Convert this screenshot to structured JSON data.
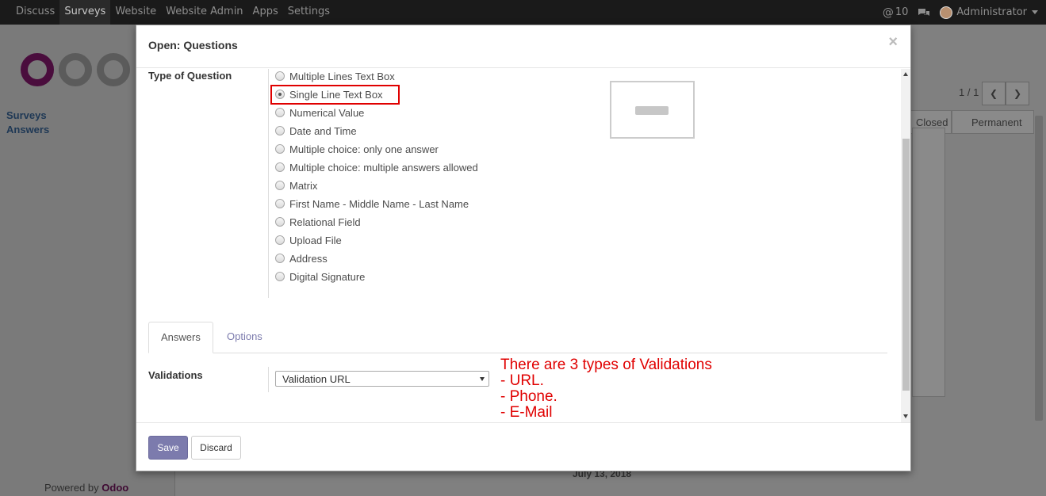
{
  "topbar": {
    "menu": [
      "Discuss",
      "Surveys",
      "Website",
      "Website Admin",
      "Apps",
      "Settings"
    ],
    "active_menu": "Surveys",
    "messages_count": "10",
    "user": "Administrator"
  },
  "background": {
    "sidebar_links": [
      "Surveys",
      "Answers"
    ],
    "powered_by_prefix": "Powered by ",
    "powered_by_brand": "Odoo",
    "pager": "1 / 1",
    "stages": [
      "Closed",
      "Permanent"
    ],
    "date_text": "July 13, 2018"
  },
  "modal": {
    "title": "Open: Questions",
    "close_symbol": "×",
    "type_label": "Type of Question",
    "question_types": [
      "Multiple Lines Text Box",
      "Single Line Text Box",
      "Numerical Value",
      "Date and Time",
      "Multiple choice: only one answer",
      "Multiple choice: multiple answers allowed",
      "Matrix",
      "First Name - Middle Name - Last Name",
      "Relational Field",
      "Upload File",
      "Address",
      "Digital Signature"
    ],
    "selected_type": "Single Line Text Box",
    "tabs": [
      "Answers",
      "Options"
    ],
    "active_tab": "Answers",
    "validations_label": "Validations",
    "validation_value": "Validation URL",
    "annotation": [
      "There are 3 types of Validations",
      "- URL.",
      "- Phone.",
      "- E-Mail"
    ],
    "save_label": "Save",
    "discard_label": "Discard"
  },
  "colors": {
    "accent": "#7c7bad",
    "highlight": "#e00000"
  }
}
